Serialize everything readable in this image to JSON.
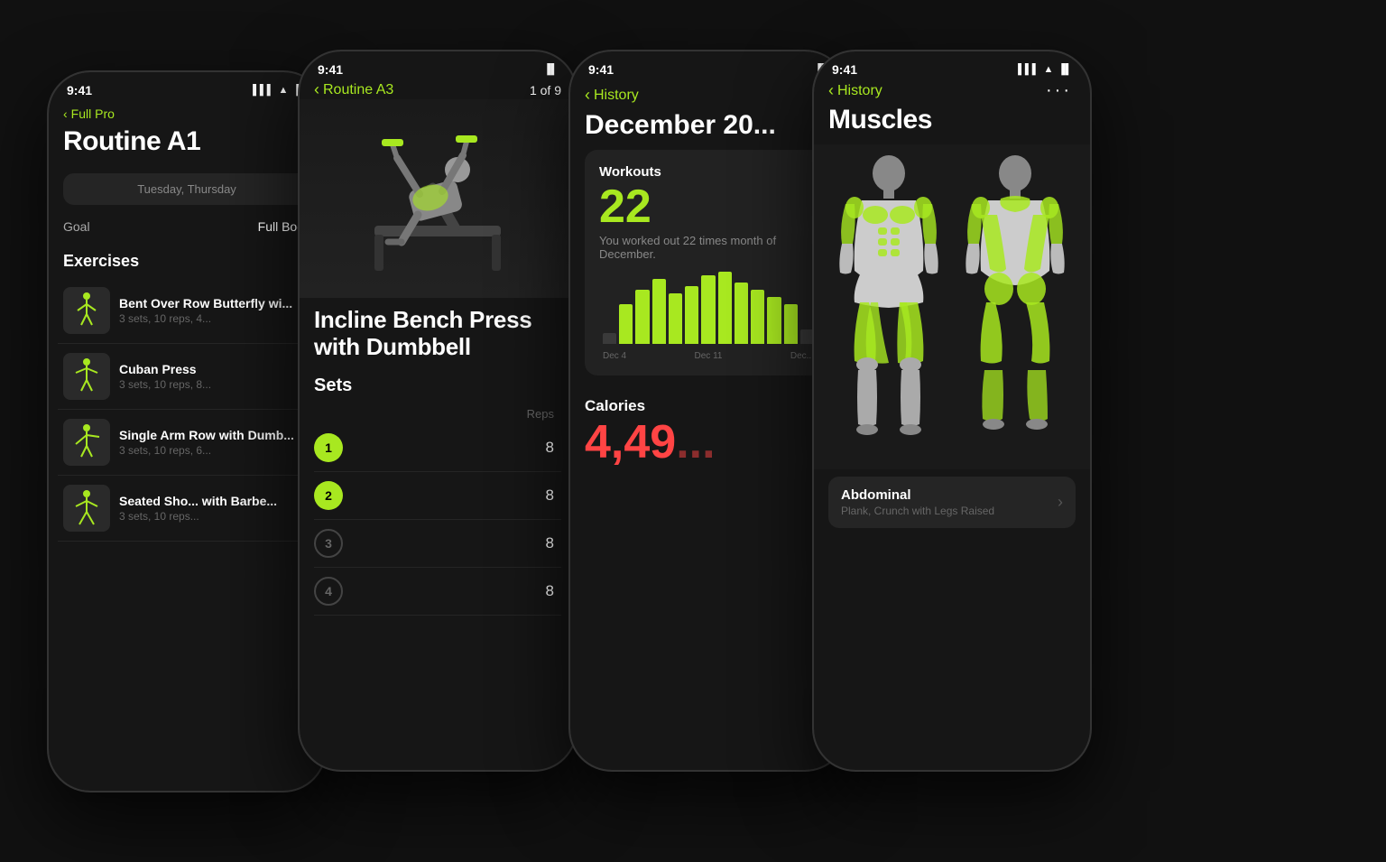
{
  "phones": [
    {
      "id": "phone1",
      "statusTime": "9:41",
      "navBack": "Full Pro",
      "title": "Routine A1",
      "schedule": "Tuesday, Thursday",
      "goal": "Full Body",
      "exercisesLabel": "Exercises",
      "exercises": [
        {
          "name": "Bent Over Row Butterfly wi...",
          "meta": "3 sets, 10 reps, 4...",
          "figureColor": "#a8e820"
        },
        {
          "name": "Cuban Press",
          "meta": "3 sets, 10 reps, 8...",
          "figureColor": "#a8e820"
        },
        {
          "name": "Single Arm Row with Dumb...",
          "meta": "3 sets, 10 reps, 6...",
          "figureColor": "#a8e820"
        },
        {
          "name": "Seated Sho... with Barbe...",
          "meta": "3 sets, 10 reps...",
          "figureColor": "#a8e820"
        }
      ]
    },
    {
      "id": "phone2",
      "statusTime": "9:41",
      "navBack": "Routine A3",
      "pageIndicator": "1 of 9",
      "exerciseName": "Incline Bench Press\nwith Dumbbell",
      "setsLabel": "Sets",
      "repsHeader": "Reps",
      "sets": [
        {
          "number": "1",
          "reps": "8",
          "done": true
        },
        {
          "number": "2",
          "reps": "8",
          "done": true
        },
        {
          "number": "3",
          "reps": "8",
          "done": false
        },
        {
          "number": "4",
          "reps": "8",
          "done": false
        }
      ]
    },
    {
      "id": "phone3",
      "statusTime": "9:41",
      "navBack": "History",
      "monthTitle": "December 20...",
      "workoutsLabel": "Workouts",
      "workoutsCount": "22",
      "workoutsDesc": "You worked out 22 times month of December.",
      "chartBars": [
        10,
        45,
        70,
        80,
        60,
        75,
        85,
        90,
        80,
        70,
        60,
        50,
        40
      ],
      "chartLabels": [
        "Dec 4",
        "Dec 11",
        "Dec..."
      ],
      "caloriesLabel": "Calories",
      "caloriesValue": "4,49..."
    },
    {
      "id": "phone4",
      "statusTime": "9:41",
      "navBack": "History",
      "title": "Muscles",
      "dotsMenu": "···",
      "muscleCard": {
        "name": "Abdominal",
        "sub": "Plank, Crunch with Legs Raised"
      }
    }
  ]
}
